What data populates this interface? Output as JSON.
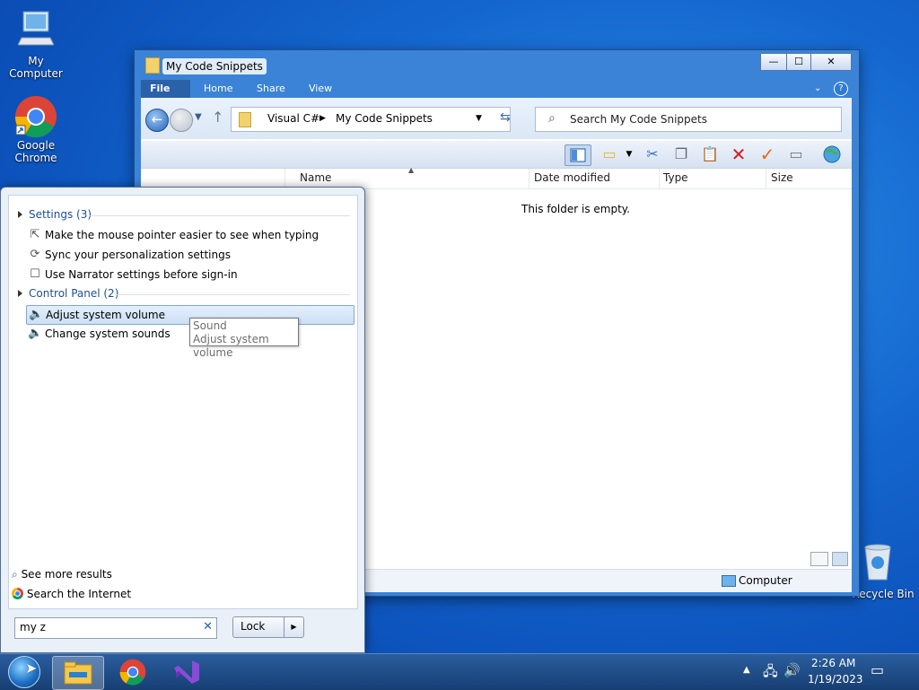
{
  "desktop": {
    "icons": [
      {
        "label": "My Computer",
        "icon": "computer-icon"
      },
      {
        "label": "Google\nChrome",
        "icon": "chrome-icon"
      },
      {
        "label": "Recycle Bin",
        "icon": "recycle-bin-icon"
      }
    ]
  },
  "explorer": {
    "title": "My Code Snippets",
    "caption_buttons": {
      "minimize": "—",
      "maximize": "☐",
      "close": "✕"
    },
    "ribbon_tabs": [
      "File",
      "Home",
      "Share",
      "View"
    ],
    "address": {
      "segments": [
        "Visual C#",
        "My Code Snippets"
      ]
    },
    "search_placeholder": "Search My Code Snippets",
    "columns": [
      "Name",
      "Date modified",
      "Type",
      "Size"
    ],
    "empty_message": "This folder is empty.",
    "status_location": "Computer"
  },
  "start_menu": {
    "groups": [
      {
        "title": "Settings (3)",
        "items": [
          {
            "label": "Make the mouse pointer easier to see when typing",
            "icon": "mouse-pointer-icon"
          },
          {
            "label": "Sync your personalization settings",
            "icon": "sync-icon"
          },
          {
            "label": "Use Narrator settings before sign-in",
            "icon": "narrator-icon"
          }
        ]
      },
      {
        "title": "Control Panel (2)",
        "items": [
          {
            "label": "Adjust system volume",
            "icon": "speaker-icon",
            "highlighted": true
          },
          {
            "label": "Change system sounds",
            "icon": "speaker-icon"
          }
        ]
      }
    ],
    "tooltip": {
      "line1": "Sound",
      "line2": "Adjust system volume"
    },
    "see_more": "See more results",
    "search_internet": "Search the Internet",
    "search_value": "my z",
    "lock_label": "Lock"
  },
  "taskbar": {
    "pinned": [
      "start-orb",
      "file-explorer-icon",
      "chrome-icon",
      "visual-studio-icon"
    ],
    "time": "2:26 AM",
    "date": "1/19/2023"
  }
}
